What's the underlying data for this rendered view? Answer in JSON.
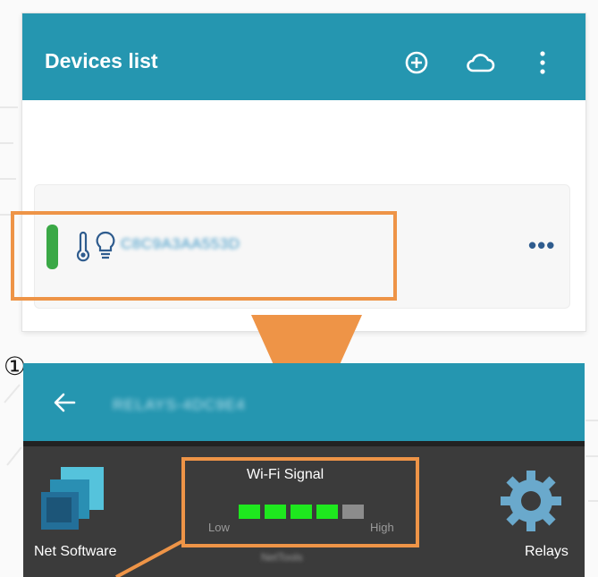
{
  "devices_list": {
    "title": "Devices list",
    "icons": [
      "add-circle-icon",
      "cloud-icon",
      "more-vert-icon"
    ],
    "device": {
      "id": "C8C9A3AA553D",
      "status_color": "#3aa846",
      "icons": [
        "thermometer-icon",
        "lightbulb-icon"
      ],
      "menu_label": "•••"
    }
  },
  "step_marker": "①",
  "device_detail": {
    "title": "RELAYS-4DC9E4",
    "tiles": {
      "net_software": "Net Software",
      "relays": "Relays",
      "hidden_label": "NetTools"
    },
    "wifi": {
      "title": "Wi-Fi Signal",
      "low_label": "Low",
      "high_label": "High",
      "level": 4,
      "max_level": 5,
      "on_color": "#1ee81e",
      "off_color": "#8c8c8c"
    }
  },
  "colors": {
    "accent": "#2596b0",
    "highlight": "#ee9447",
    "panel_dark": "#3b3b3b"
  }
}
